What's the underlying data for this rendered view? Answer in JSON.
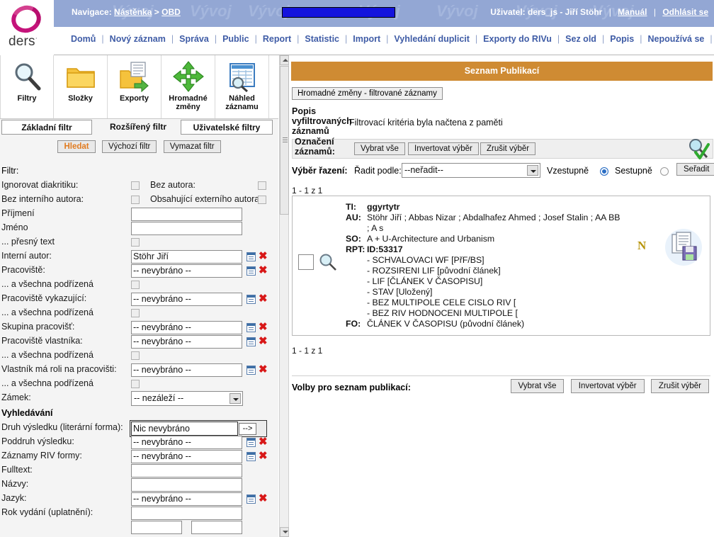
{
  "brand": {
    "name": "ders",
    "tm": "·",
    "accent": "#c4137a"
  },
  "header": {
    "nav_prefix": "Navigace:",
    "nav_item1": "Nástěnka",
    "nav_sep": ">",
    "nav_item2": "OBD",
    "watermark": "Vývoj",
    "user_label": "Uživatel:",
    "user_value": "ders_js - Jiří Stöhr",
    "manual_link": "Manuál",
    "logout_link": "Odhlásit se",
    "progress_color": "#1414dd",
    "bar_bg": "#93a7d4"
  },
  "menu": {
    "items": [
      "Domů",
      "Nový záznam",
      "Správa",
      "Public",
      "Report",
      "Statistic",
      "Import",
      "Vyhledání duplicit",
      "Exporty do RIVu",
      "Sez old",
      "Popis",
      "Nepoužívá se"
    ]
  },
  "toolbar": {
    "buttons": [
      {
        "label": "Filtry",
        "icon": "magnifier-icon"
      },
      {
        "label": "Složky",
        "icon": "folder-icon"
      },
      {
        "label": "Exporty",
        "icon": "export-folder-icon"
      },
      {
        "label": "Hromadné změny",
        "icon": "move-arrows-icon"
      },
      {
        "label": "Náhled záznamu",
        "icon": "preview-table-icon"
      }
    ]
  },
  "tabs": {
    "basic": "Základní filtr",
    "advanced": "Rozšířený filtr",
    "user": "Uživatelské filtry",
    "active": "advanced"
  },
  "filter_actions": {
    "search": "Hledat",
    "default": "Výchozí filtr",
    "clear": "Vymazat filtr"
  },
  "filter": {
    "title": "Filtr:",
    "rows": [
      {
        "label": "Ignorovat diakritiku:",
        "type": "checkbox",
        "checked": false,
        "label2": "Bez autora:",
        "type2": "checkbox",
        "checked2": false
      },
      {
        "label": "Bez interního autora:",
        "type": "checkbox",
        "checked": false,
        "label2": "Obsahující externího autora:",
        "type2": "checkbox",
        "checked2": false
      },
      {
        "label": "Příjmení",
        "type": "text",
        "value": ""
      },
      {
        "label": "Jméno",
        "type": "text",
        "value": ""
      },
      {
        "label": "... přesný text",
        "type": "checkbox",
        "checked": false
      },
      {
        "label": "Interní autor:",
        "type": "picker",
        "value": "Stöhr Jiří"
      },
      {
        "label": "Pracoviště:",
        "type": "picker",
        "value": "-- nevybráno --"
      },
      {
        "label": "... a všechna podřízená",
        "type": "checkbox",
        "checked": false
      },
      {
        "label": "Pracoviště vykazující:",
        "type": "picker",
        "value": "-- nevybráno --"
      },
      {
        "label": "... a všechna podřízená",
        "type": "checkbox",
        "checked": false
      },
      {
        "label": "Skupina pracovišť:",
        "type": "picker",
        "value": "-- nevybráno --"
      },
      {
        "label": "Pracoviště vlastníka:",
        "type": "picker",
        "value": "-- nevybráno --"
      },
      {
        "label": "... a všechna podřízená",
        "type": "checkbox",
        "checked": false
      },
      {
        "label": "Vlastník má roli na pracovišti:",
        "type": "picker",
        "value": "-- nevybráno --"
      },
      {
        "label": "... a všechna podřízená",
        "type": "checkbox",
        "checked": false
      },
      {
        "label": "Zámek:",
        "type": "select",
        "value": "-- nezáleží --"
      }
    ],
    "section2_title": "Vyhledávání",
    "rows2": [
      {
        "label": "Druh výsledku (literární forma):",
        "type": "arrowbox",
        "value": "Nic nevybráno",
        "arrow": "-->"
      },
      {
        "label": "Poddruh výsledku:",
        "type": "picker",
        "value": "-- nevybráno --"
      },
      {
        "label": "Záznamy RIV formy:",
        "type": "picker",
        "value": "-- nevybráno --"
      },
      {
        "label": "Fulltext:",
        "type": "text",
        "value": ""
      },
      {
        "label": "Názvy:",
        "type": "text",
        "value": ""
      },
      {
        "label": "Jazyk:",
        "type": "picker",
        "value": "-- nevybráno --"
      },
      {
        "label": "Rok vydání (uplatnění):",
        "type": "text",
        "value": ""
      }
    ]
  },
  "results": {
    "panel_title": "Seznam Publikací",
    "panel_title_bg": "#cf8b33",
    "bulk_button": "Hromadné změny - filtrované záznamy",
    "desc_label": "Popis vyfiltrovaných záznamů",
    "desc_value": "Filtrovací kritéria byla načtena z paměti",
    "mark_label": "Označení záznamů:",
    "select_all": "Vybrat vše",
    "invert": "Invertovat výběr",
    "deselect": "Zrušit výběr",
    "sort_choice_label": "Výběr řazení:",
    "sort_by_label": "Řadit podle:",
    "sort_by_value": "--neřadit--",
    "asc_label": "Vzestupně",
    "desc_label_radio": "Sestupně",
    "asc_selected": true,
    "sort_button": "Seřadit",
    "count_top": "1 - 1 z 1",
    "count_bottom": "1 - 1 z 1",
    "options_label": "Volby pro seznam publikací:"
  },
  "record": {
    "ti_tag": "TI:",
    "ti_value": "ggyrtytr",
    "au_tag": "AU:",
    "au_value": "Stöhr Jiří ;  Abbas Nizar ;  Abdalhafez Ahmed ;  Josef Stalin ;  AA BB",
    "au_value2": ";  A s",
    "so_tag": "SO:",
    "so_value": "A + U-Architecture and Urbanism",
    "rpt_tag": "RPT:",
    "rpt_value": "ID:53317",
    "rpt_lines": [
      "- SCHVALOVACI WF [PřF/BS]",
      "- ROZSIRENI LIF [původní článek]",
      "- LIF [ČLÁNEK V ČASOPISU]",
      "- STAV [Uložený]",
      "- BEZ MULTIPOLE CELE CISLO RIV [",
      "- BEZ RIV HODNOCENI MULTIPOLE ["
    ],
    "fo_tag": "FO:",
    "fo_value": "ČLÁNEK V ČASOPISU  (původní článek)",
    "new_badge": "N",
    "new_badge_color": "#b8960e"
  }
}
